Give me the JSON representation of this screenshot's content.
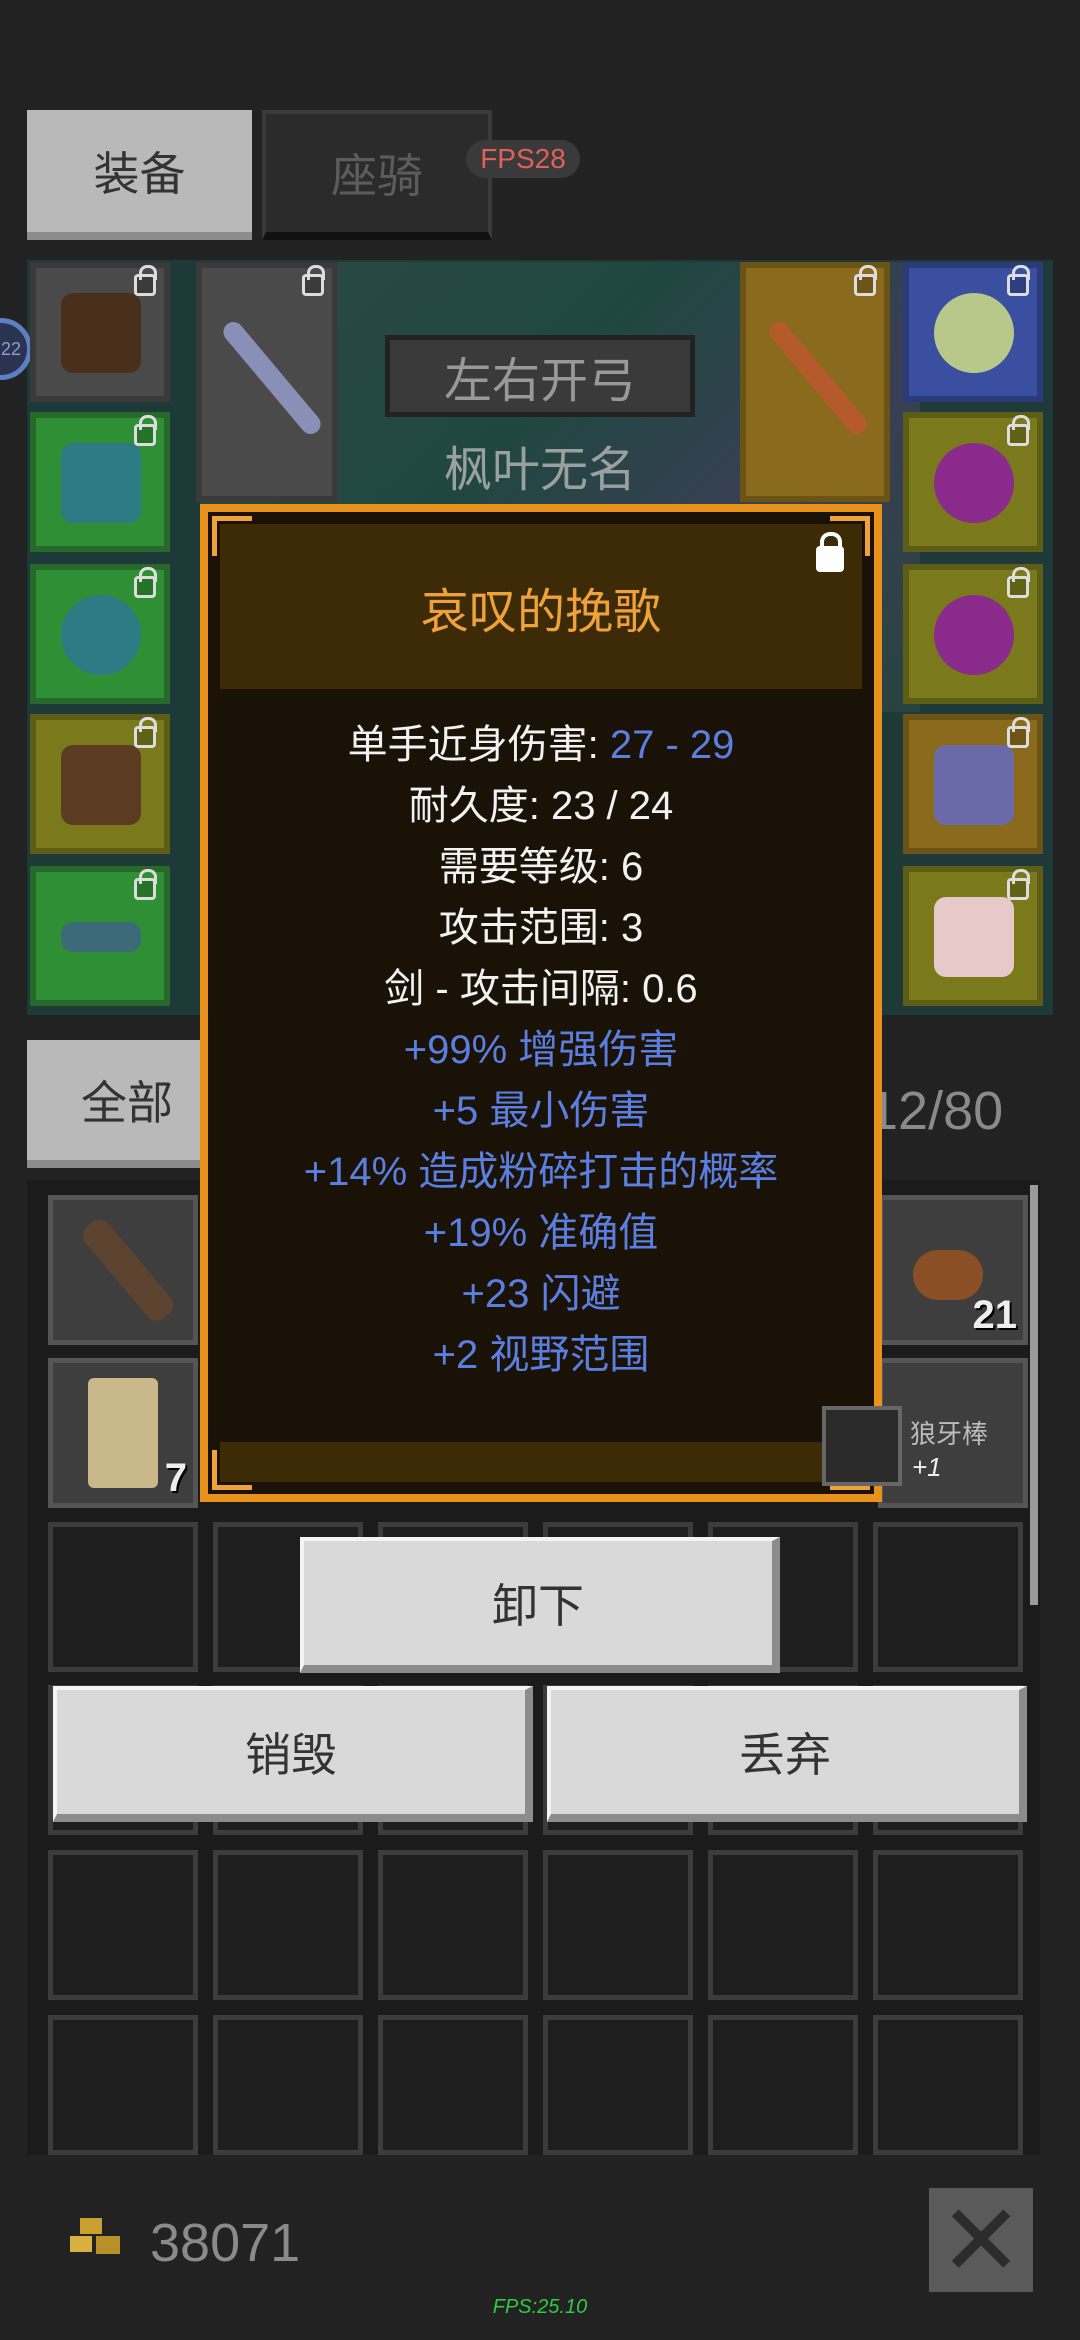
{
  "tabs": {
    "equipment": "装备",
    "mount": "座骑"
  },
  "fps_top": "FPS28",
  "character": {
    "title": "左右开弓",
    "name": "枫叶无名",
    "level_badge": "22"
  },
  "tooltip": {
    "title": "哀叹的挽歌",
    "damage_label": "单手近身伤害: ",
    "damage_value": "27 - 29",
    "durability": "耐久度: 23 / 24",
    "level_req": "需要等级: 6",
    "attack_range": "攻击范围: 3",
    "attack_interval": "剑 - 攻击间隔: 0.6",
    "mods": [
      "+99% 增强伤害",
      "+5 最小伤害",
      "+14% 造成粉碎打击的概率",
      "+19% 准确值",
      "+23 闪避",
      "+2 视野范围"
    ]
  },
  "equipped_compare": {
    "name": "狼牙棒",
    "plus": "+1"
  },
  "bag": {
    "filter_tab": "全部",
    "capacity_text": "12/80",
    "counts": [
      "21",
      "7"
    ]
  },
  "actions": {
    "unequip": "卸下",
    "destroy": "销毁",
    "drop": "丢弃"
  },
  "footer": {
    "gold": "38071",
    "fps": "FPS:25.10",
    "close_icon": "close-icon"
  },
  "colors": {
    "tooltip_border": "#e8921c",
    "mod_blue": "#5a7fe0",
    "title_orange": "#f0a23a"
  }
}
